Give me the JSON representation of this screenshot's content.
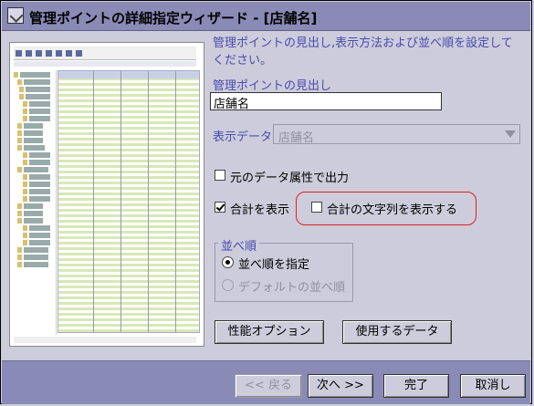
{
  "window": {
    "title": "管理ポイントの詳細指定ウィザード - [店舗名]"
  },
  "description": "管理ポイントの見出し,表示方法および並べ順を設定してください。",
  "heading_field": {
    "label": "管理ポイントの見出し",
    "value": "店舗名"
  },
  "display_data": {
    "label": "表示データ:",
    "value": "店舗名",
    "enabled": false
  },
  "options": {
    "original_attr_label": "元のデータ属性で出力",
    "original_attr_checked": false,
    "show_total_label": "合計を表示",
    "show_total_checked": true,
    "show_total_string_label": "合計の文字列を表示する",
    "show_total_string_checked": false
  },
  "sort_group": {
    "title": "並べ順",
    "specify_label": "並べ順を指定",
    "specify_selected": true,
    "default_label": "デフォルトの並べ順",
    "default_enabled": false
  },
  "buttons": {
    "performance": "性能オプション",
    "data_used": "使用するデータ",
    "back": "<< 戻る",
    "next": "次へ >>",
    "finish": "完了",
    "cancel": "取消し"
  },
  "colors": {
    "titlebar": "#8a8ab6",
    "background": "#ccccdb",
    "accent_text": "#4a4ab0",
    "highlight_border": "#e02020"
  }
}
